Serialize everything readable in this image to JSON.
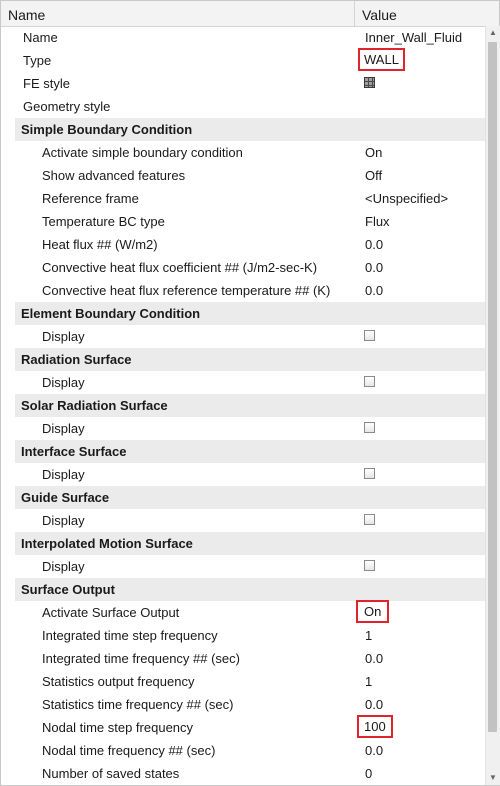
{
  "header": {
    "name_label": "Name",
    "value_label": "Value"
  },
  "general": {
    "name_label": "Name",
    "name_value": "Inner_Wall_Fluid",
    "type_label": "Type",
    "type_value": "WALL",
    "fe_style_label": "FE style",
    "geometry_style_label": "Geometry style"
  },
  "simple_bc": {
    "title": "Simple Boundary Condition",
    "rows": [
      {
        "label": "Activate simple boundary condition",
        "value": "On"
      },
      {
        "label": "Show advanced features",
        "value": "Off"
      },
      {
        "label": "Reference frame",
        "value": "<Unspecified>"
      },
      {
        "label": "Temperature BC type",
        "value": "Flux"
      },
      {
        "label": "Heat flux ## (W/m2)",
        "value": "0.0"
      },
      {
        "label": "Convective heat flux coefficient ## (J/m2-sec-K)",
        "value": "0.0"
      },
      {
        "label": "Convective heat flux reference temperature ## (K)",
        "value": "0.0"
      }
    ]
  },
  "sections": [
    {
      "title": "Element Boundary Condition",
      "row_label": "Display"
    },
    {
      "title": "Radiation Surface",
      "row_label": "Display"
    },
    {
      "title": "Solar Radiation Surface",
      "row_label": "Display"
    },
    {
      "title": "Interface Surface",
      "row_label": "Display"
    },
    {
      "title": "Guide Surface",
      "row_label": "Display"
    },
    {
      "title": "Interpolated Motion Surface",
      "row_label": "Display"
    }
  ],
  "surface_output": {
    "title": "Surface Output",
    "rows": [
      {
        "label": "Activate Surface Output",
        "value": "On"
      },
      {
        "label": "Integrated time step frequency",
        "value": "1"
      },
      {
        "label": "Integrated time frequency ## (sec)",
        "value": "0.0"
      },
      {
        "label": "Statistics output frequency",
        "value": "1"
      },
      {
        "label": "Statistics time frequency ## (sec)",
        "value": "0.0"
      },
      {
        "label": "Nodal time step frequency",
        "value": "100"
      },
      {
        "label": "Nodal time frequency ## (sec)",
        "value": "0.0"
      },
      {
        "label": "Number of saved states",
        "value": "0"
      }
    ]
  },
  "icons": {
    "fe_style": "mesh-cube-icon"
  },
  "colors": {
    "highlight": "#e0242b",
    "section_bg": "#ebebeb"
  }
}
